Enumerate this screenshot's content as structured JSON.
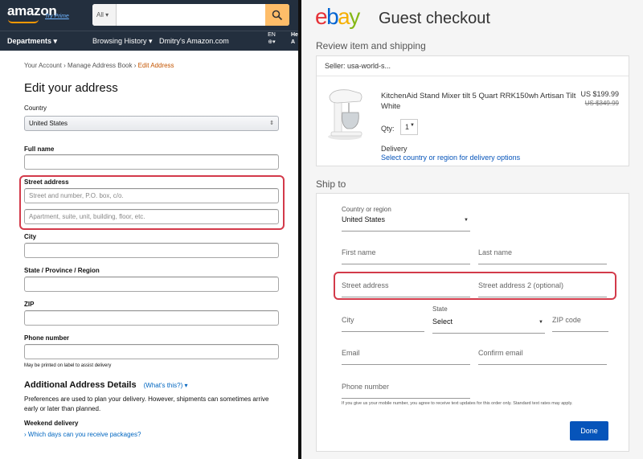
{
  "amazon": {
    "logo": "amazon",
    "try_prime": "Try Prime",
    "search_category": "All",
    "nav": {
      "departments": "Departments",
      "browsing_history": "Browsing History",
      "user_amazon": "Dmitry's Amazon.com",
      "lang": "EN",
      "hello_partial": "He",
      "account_partial": "A"
    },
    "breadcrumb": {
      "your_account": "Your Account",
      "manage_book": "Manage Address Book",
      "current": "Edit Address",
      "sep": "›"
    },
    "page_title": "Edit your address",
    "country_label": "Country",
    "country_value": "United States",
    "fullname_label": "Full name",
    "street_label": "Street address",
    "street1_placeholder": "Street and number, P.O. box, c/o.",
    "street2_placeholder": "Apartment, suite, unit, building, floor, etc.",
    "city_label": "City",
    "state_label": "State / Province / Region",
    "zip_label": "ZIP",
    "phone_label": "Phone number",
    "phone_note": "May be printed on label to assist delivery",
    "additional_title": "Additional Address Details",
    "whats_this": "(What's this?)",
    "additional_desc": "Preferences are used to plan your delivery. However, shipments can sometimes arrive early or later than planned.",
    "weekend_label": "Weekend delivery",
    "weekend_link": "Which days can you receive packages?"
  },
  "ebay": {
    "logo": {
      "e": "e",
      "b": "b",
      "a": "a",
      "y": "y"
    },
    "page_title": "Guest checkout",
    "review_title": "Review item and shipping",
    "seller": "Seller: usa-world-s...",
    "product_title": "KitchenAid Stand Mixer tilt 5 Quart RRK150wh Artisan Tilt White",
    "price": "US $199.99",
    "old_price": "US $349.99",
    "qty_label": "Qty:",
    "qty_value": "1",
    "delivery_label": "Delivery",
    "delivery_link": "Select country or region for delivery options",
    "ship_to_title": "Ship to",
    "country_label": "Country or region",
    "country_value": "United States",
    "first_name": "First name",
    "last_name": "Last name",
    "street1": "Street address",
    "street2": "Street address 2 (optional)",
    "city": "City",
    "state_label": "State",
    "state_value": "Select",
    "zip": "ZIP code",
    "email": "Email",
    "confirm_email": "Confirm email",
    "phone": "Phone number",
    "disclaimer": "If you give us your mobile number, you agree to receive text updates for this order only. Standard text rates may apply.",
    "done": "Done"
  },
  "colors": {
    "amazon_dark": "#232f3e",
    "amazon_orange": "#febd69",
    "highlight": "#d33a4a",
    "ebay_blue": "#0654ba"
  }
}
